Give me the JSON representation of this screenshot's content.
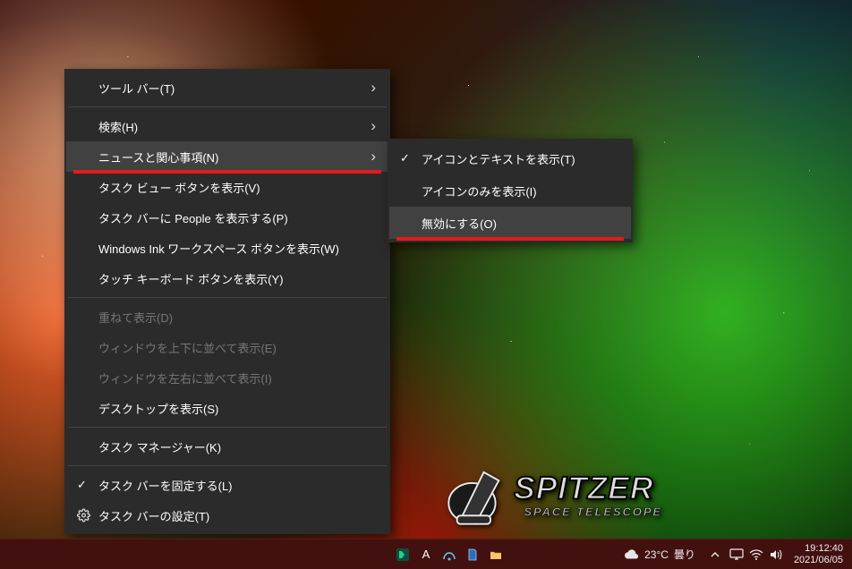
{
  "wallpaper": {
    "subject": "nebula",
    "logo_main": "SPITZER",
    "logo_sub": "SPACE TELESCOPE"
  },
  "context_menu": {
    "highlighted_index": 2,
    "items": [
      {
        "label": "ツール バー(T)",
        "has_submenu": true,
        "enabled": true
      },
      {
        "label": "検索(H)",
        "has_submenu": true,
        "enabled": true
      },
      {
        "label": "ニュースと関心事項(N)",
        "has_submenu": true,
        "enabled": true,
        "underline": true
      },
      {
        "label": "タスク ビュー ボタンを表示(V)",
        "enabled": true
      },
      {
        "label": "タスク バーに People を表示する(P)",
        "enabled": true
      },
      {
        "label": "Windows Ink ワークスペース ボタンを表示(W)",
        "enabled": true
      },
      {
        "label": "タッチ キーボード ボタンを表示(Y)",
        "enabled": true
      },
      {
        "type": "sep"
      },
      {
        "label": "重ねて表示(D)",
        "enabled": false
      },
      {
        "label": "ウィンドウを上下に並べて表示(E)",
        "enabled": false
      },
      {
        "label": "ウィンドウを左右に並べて表示(I)",
        "enabled": false
      },
      {
        "label": "デスクトップを表示(S)",
        "enabled": true
      },
      {
        "type": "sep"
      },
      {
        "label": "タスク マネージャー(K)",
        "enabled": true
      },
      {
        "type": "sep"
      },
      {
        "label": "タスク バーを固定する(L)",
        "enabled": true,
        "checked": true
      },
      {
        "label": "タスク バーの設定(T)",
        "enabled": true,
        "icon": "gear"
      }
    ]
  },
  "submenu": {
    "highlighted_index": 2,
    "items": [
      {
        "label": "アイコンとテキストを表示(T)",
        "checked": true
      },
      {
        "label": "アイコンのみを表示(I)"
      },
      {
        "label": "無効にする(O)",
        "underline": true
      }
    ]
  },
  "taskbar": {
    "accent_color": "#431010",
    "tray_left_icons": [
      "dashlane-icon",
      "ime-a-icon",
      "wifi-analyzer-icon",
      "sdcard-icon",
      "folder-icon"
    ],
    "weather": {
      "icon": "cloud",
      "temp": "23°C",
      "text": "曇り"
    },
    "systray_icons": [
      "chevron-up-icon",
      "monitor-icon",
      "wifi-icon",
      "volume-icon"
    ],
    "clock": {
      "time": "19:12:40",
      "date": "2021/06/05"
    }
  }
}
